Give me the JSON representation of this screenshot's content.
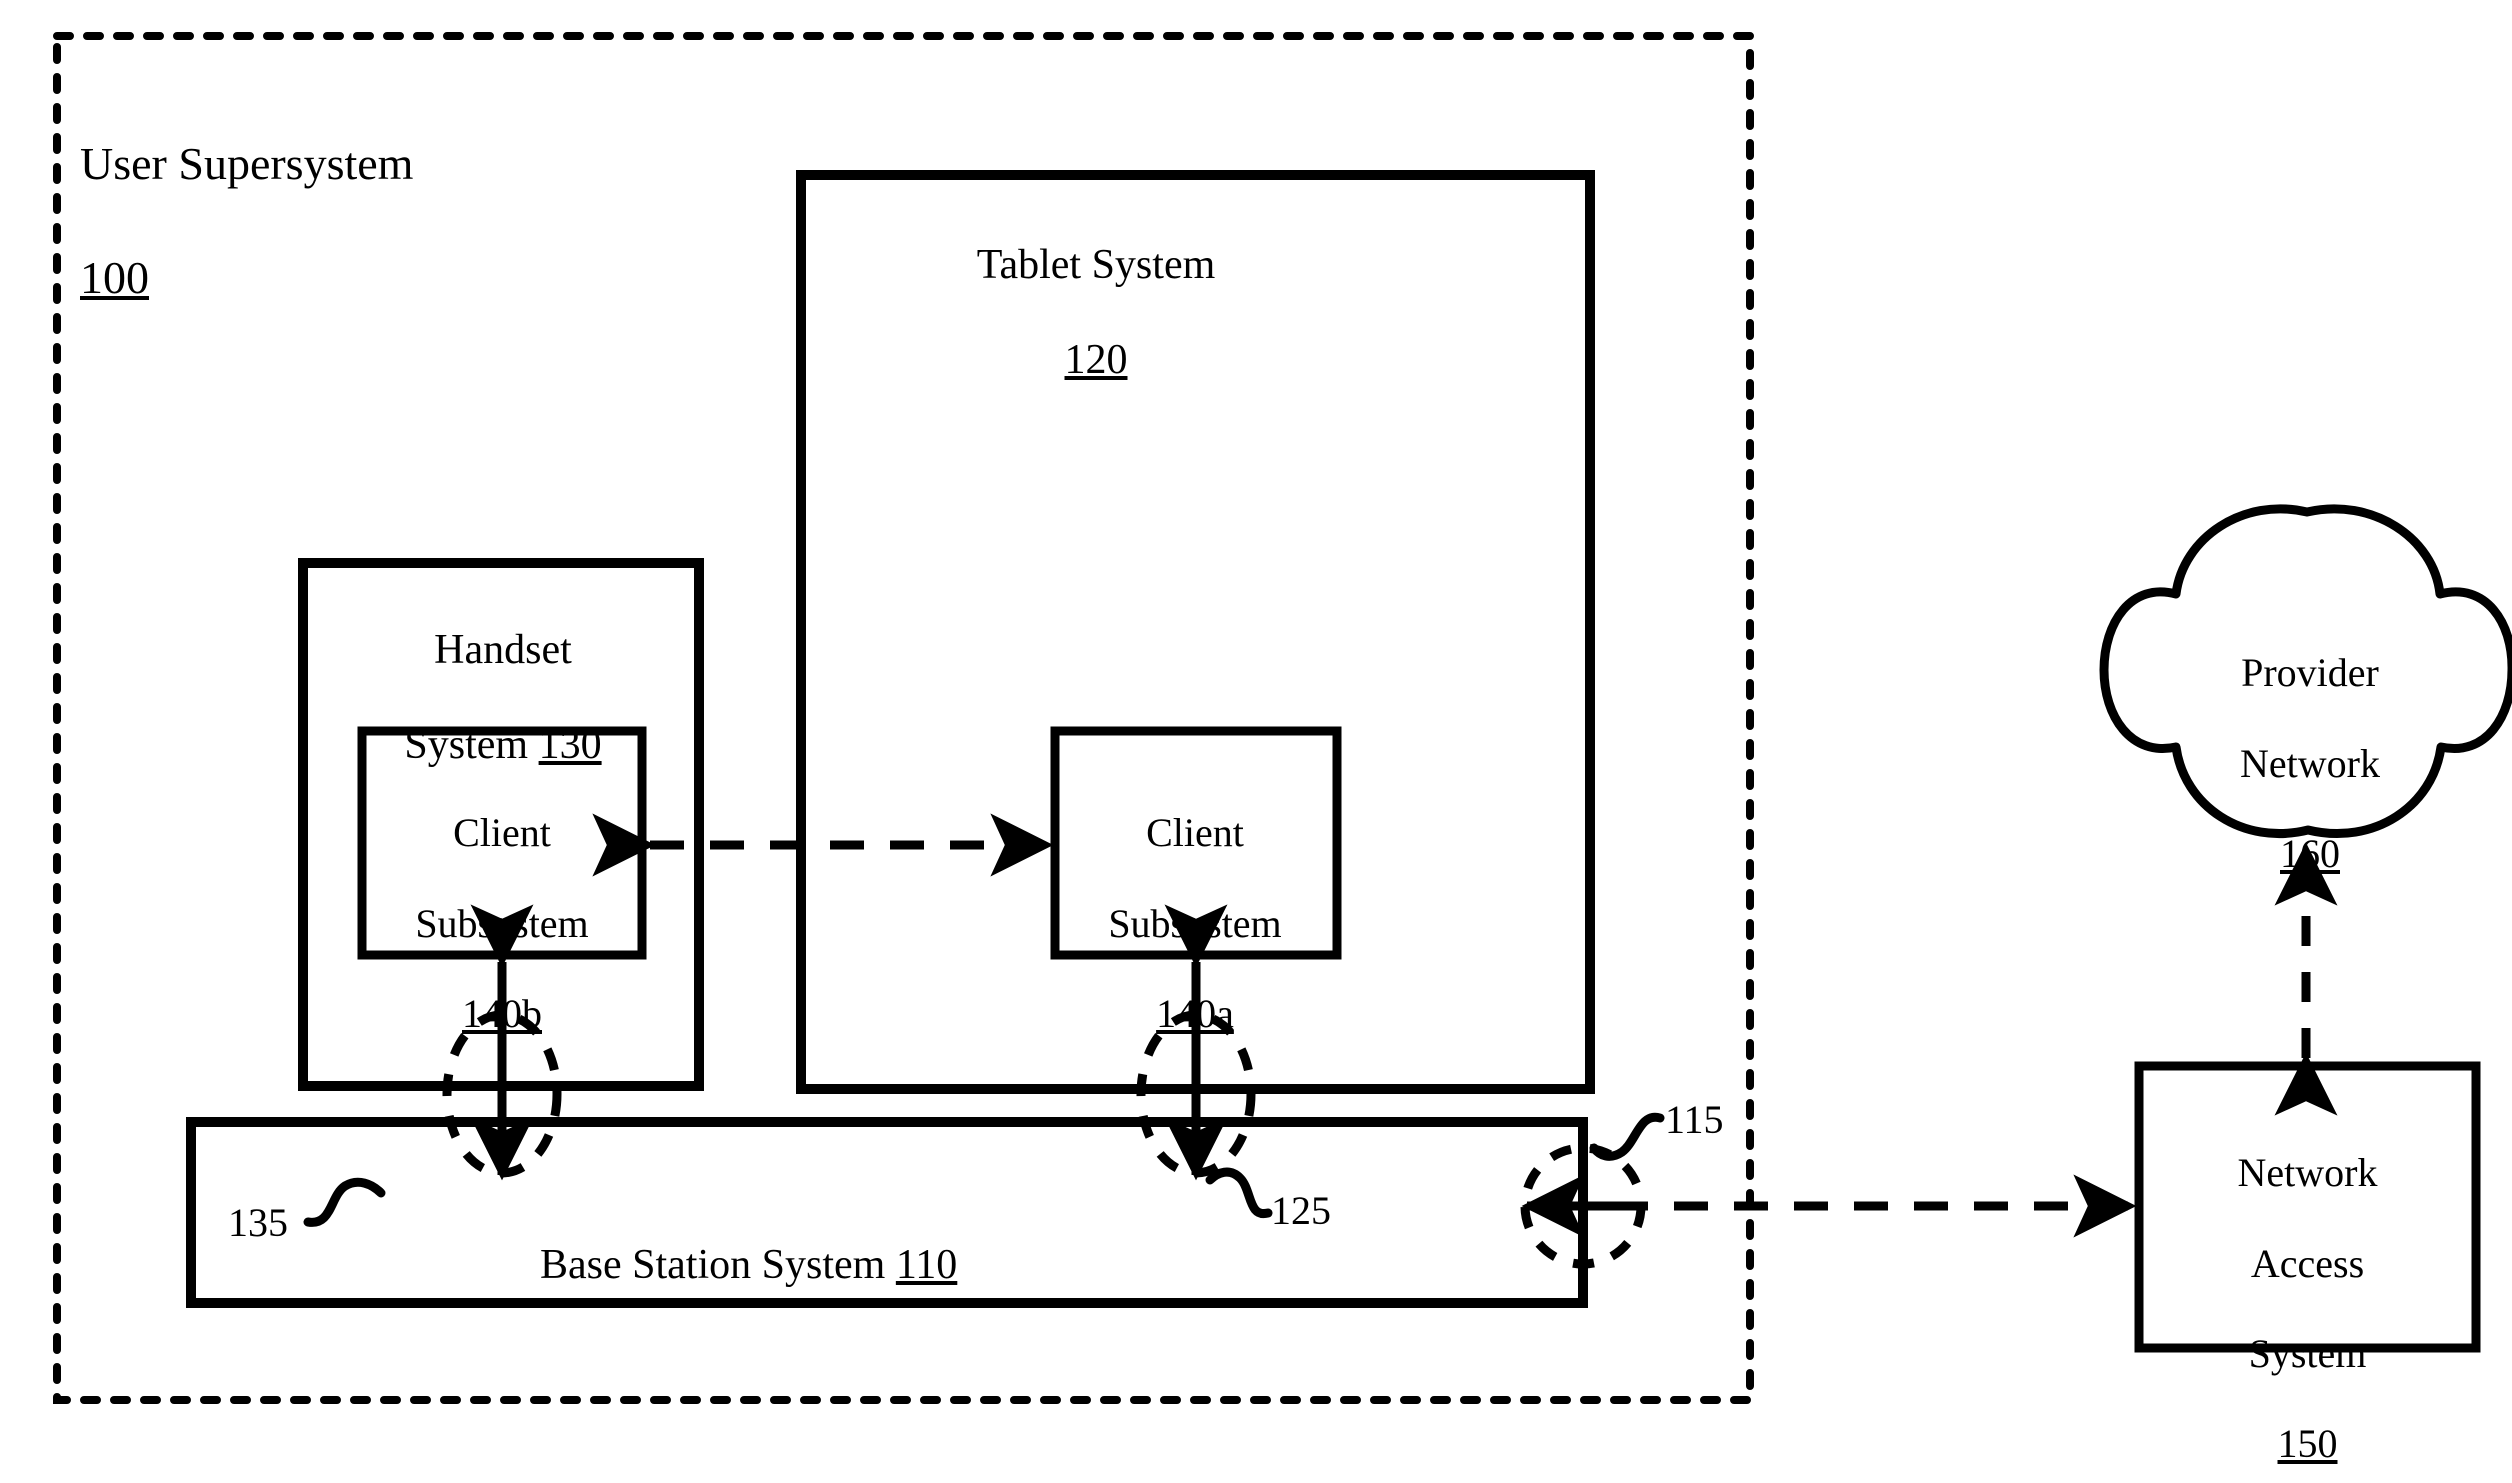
{
  "diagram": {
    "outer": {
      "title": "User Supersystem",
      "ref": "100"
    },
    "blocks": {
      "tablet": {
        "title": "Tablet System",
        "ref": "120"
      },
      "handset": {
        "title": "Handset",
        "title2": "System ",
        "ref": "130"
      },
      "client_b": {
        "line1": "Client",
        "line2": "Subsystem",
        "ref": "140b"
      },
      "client_a": {
        "line1": "Client",
        "line2": "Subsystem",
        "ref": "140a"
      },
      "base_station": {
        "title": "Base Station System ",
        "ref": "110"
      },
      "provider_network": {
        "line1": "Provider",
        "line2": "Network",
        "ref": "160"
      },
      "network_access": {
        "line1": "Network",
        "line2": "Access",
        "line3": "System",
        "ref": "150"
      }
    },
    "reference_markers": {
      "handset_link": "135",
      "tablet_link": "125",
      "network_link": "115"
    },
    "colors": {
      "stroke": "#000000",
      "background": "#ffffff"
    }
  }
}
